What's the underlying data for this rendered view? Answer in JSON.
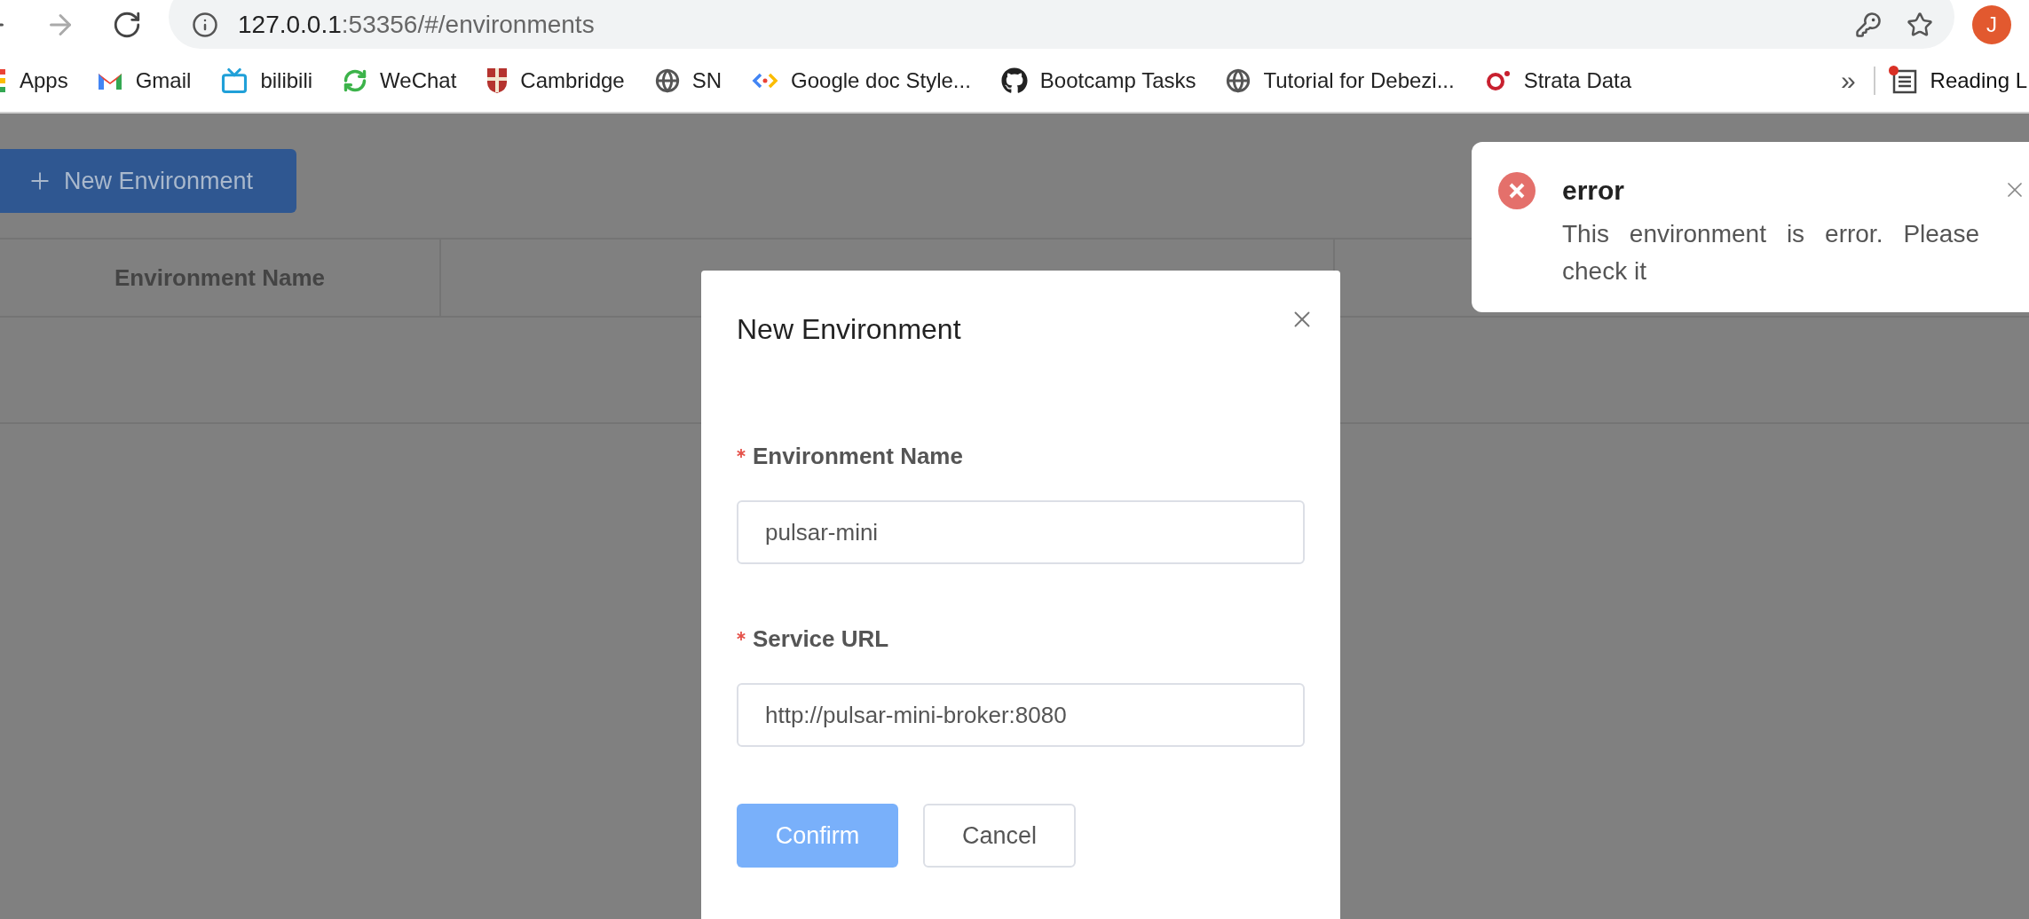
{
  "browser": {
    "url_host": "127.0.0.1",
    "url_path": ":53356/#/environments",
    "profile_initial": "J"
  },
  "bookmarks": [
    {
      "label": "Apps",
      "kind": "grid"
    },
    {
      "label": "Gmail",
      "kind": "mail"
    },
    {
      "label": "bilibili",
      "kind": "tv"
    },
    {
      "label": "WeChat",
      "kind": "arrows"
    },
    {
      "label": "Cambridge",
      "kind": "shield"
    },
    {
      "label": "SN",
      "kind": "globe"
    },
    {
      "label": "Google doc Style...",
      "kind": "code"
    },
    {
      "label": "Bootcamp Tasks",
      "kind": "cat"
    },
    {
      "label": "Tutorial for Debezi...",
      "kind": "globe"
    },
    {
      "label": "Strata Data",
      "kind": "ring"
    }
  ],
  "bookmarks_overflow": "»",
  "reading_list": "Reading L",
  "page": {
    "new_button": "New Environment",
    "table": {
      "columns": [
        "Environment Name"
      ]
    }
  },
  "modal": {
    "title": "New Environment",
    "fields": [
      {
        "label": "Environment Name",
        "required": true,
        "value": "pulsar-mini"
      },
      {
        "label": "Service URL",
        "required": true,
        "value": "http://pulsar-mini-broker:8080"
      }
    ],
    "buttons": [
      {
        "label": "Confirm",
        "kind": "primary"
      },
      {
        "label": "Cancel",
        "kind": "default"
      }
    ]
  },
  "notification": {
    "title": "error",
    "message": "This environment is error. Please check it"
  }
}
